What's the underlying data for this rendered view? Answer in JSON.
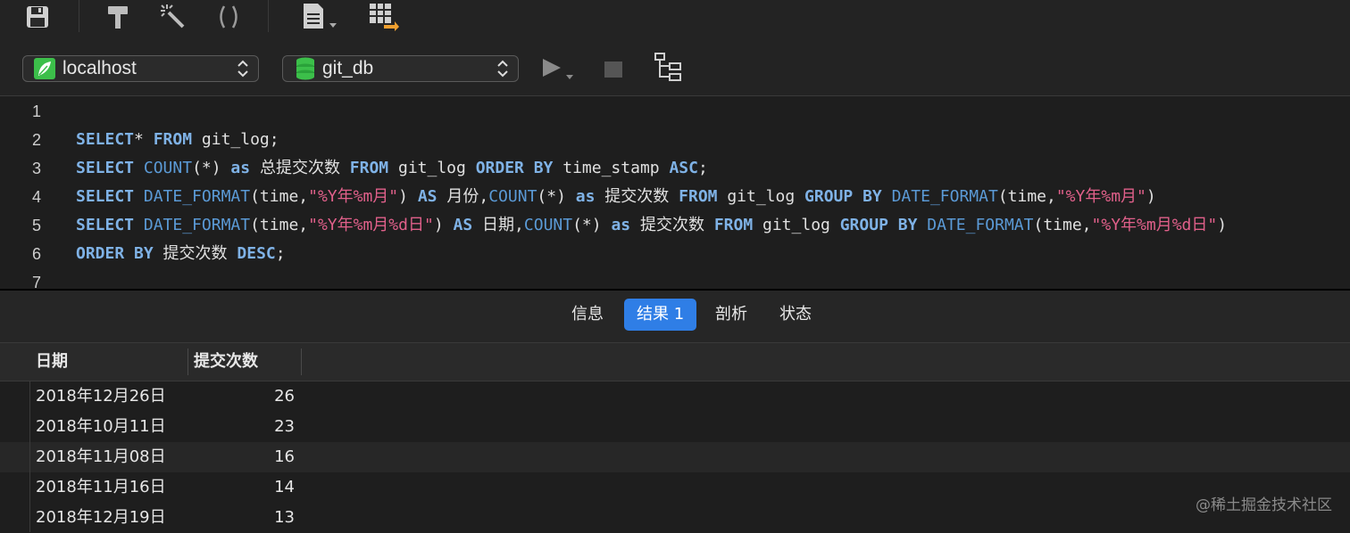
{
  "toolbar": {
    "icons": [
      "save-icon",
      "hammer-icon",
      "magic-wand-icon",
      "parentheses-icon",
      "document-icon",
      "export-icon"
    ]
  },
  "connection": {
    "server": "localhost",
    "database": "git_db",
    "icons": [
      "run-icon",
      "stop-icon",
      "explain-icon"
    ]
  },
  "editor": {
    "lines": [
      {
        "n": "1",
        "tokens": []
      },
      {
        "n": "2",
        "tokens": [
          [
            "kw",
            "SELECT"
          ],
          [
            "pl",
            "* "
          ],
          [
            "kw",
            "FROM"
          ],
          [
            "pl",
            " git_log;"
          ]
        ]
      },
      {
        "n": "3",
        "tokens": [
          [
            "kw",
            "SELECT"
          ],
          [
            "pl",
            " "
          ],
          [
            "fn",
            "COUNT"
          ],
          [
            "pl",
            "(*) "
          ],
          [
            "kw",
            "as"
          ],
          [
            "pl",
            " 总提交次数 "
          ],
          [
            "kw",
            "FROM"
          ],
          [
            "pl",
            " git_log "
          ],
          [
            "kw",
            "ORDER BY"
          ],
          [
            "pl",
            " time_stamp "
          ],
          [
            "kw",
            "ASC"
          ],
          [
            "pl",
            ";"
          ]
        ]
      },
      {
        "n": "4",
        "tokens": [
          [
            "kw",
            "SELECT"
          ],
          [
            "pl",
            " "
          ],
          [
            "fn",
            "DATE_FORMAT"
          ],
          [
            "pl",
            "(time,"
          ],
          [
            "str",
            "\"%Y年%m月\""
          ],
          [
            "pl",
            ") "
          ],
          [
            "kw",
            "AS"
          ],
          [
            "pl",
            " 月份,"
          ],
          [
            "fn",
            "COUNT"
          ],
          [
            "pl",
            "(*) "
          ],
          [
            "kw",
            "as"
          ],
          [
            "pl",
            " 提交次数 "
          ],
          [
            "kw",
            "FROM"
          ],
          [
            "pl",
            " git_log "
          ],
          [
            "kw",
            "GROUP BY"
          ],
          [
            "pl",
            " "
          ],
          [
            "fn",
            "DATE_FORMAT"
          ],
          [
            "pl",
            "(time,"
          ],
          [
            "str",
            "\"%Y年%m月\""
          ],
          [
            "pl",
            ")"
          ]
        ]
      },
      {
        "n": "5",
        "tokens": [
          [
            "kw",
            "SELECT"
          ],
          [
            "pl",
            " "
          ],
          [
            "fn",
            "DATE_FORMAT"
          ],
          [
            "pl",
            "(time,"
          ],
          [
            "str",
            "\"%Y年%m月%d日\""
          ],
          [
            "pl",
            ") "
          ],
          [
            "kw",
            "AS"
          ],
          [
            "pl",
            " 日期,"
          ],
          [
            "fn",
            "COUNT"
          ],
          [
            "pl",
            "(*) "
          ],
          [
            "kw",
            "as"
          ],
          [
            "pl",
            " 提交次数 "
          ],
          [
            "kw",
            "FROM"
          ],
          [
            "pl",
            " git_log "
          ],
          [
            "kw",
            "GROUP BY"
          ],
          [
            "pl",
            " "
          ],
          [
            "fn",
            "DATE_FORMAT"
          ],
          [
            "pl",
            "(time,"
          ],
          [
            "str",
            "\"%Y年%m月%d日\""
          ],
          [
            "pl",
            ")"
          ]
        ]
      },
      {
        "n": "6",
        "tokens": [
          [
            "kw",
            "ORDER BY"
          ],
          [
            "pl",
            " 提交次数 "
          ],
          [
            "kw",
            "DESC"
          ],
          [
            "pl",
            ";"
          ]
        ]
      },
      {
        "n": "7",
        "tokens": []
      }
    ]
  },
  "tabs": [
    {
      "label": "信息",
      "active": false
    },
    {
      "label": "结果 1",
      "active": true
    },
    {
      "label": "剖析",
      "active": false
    },
    {
      "label": "状态",
      "active": false
    }
  ],
  "grid": {
    "columns": [
      "日期",
      "提交次数"
    ],
    "rows": [
      [
        "2018年12月26日",
        "26"
      ],
      [
        "2018年10月11日",
        "23"
      ],
      [
        "2018年11月08日",
        "16"
      ],
      [
        "2018年11月16日",
        "14"
      ],
      [
        "2018年12月19日",
        "13"
      ]
    ]
  },
  "watermark": "@稀土掘金技术社区",
  "colors": {
    "keyword": "#7fb2e6",
    "function": "#5b9ad6",
    "string": "#e0608a",
    "active_tab": "#2f7ee6"
  }
}
